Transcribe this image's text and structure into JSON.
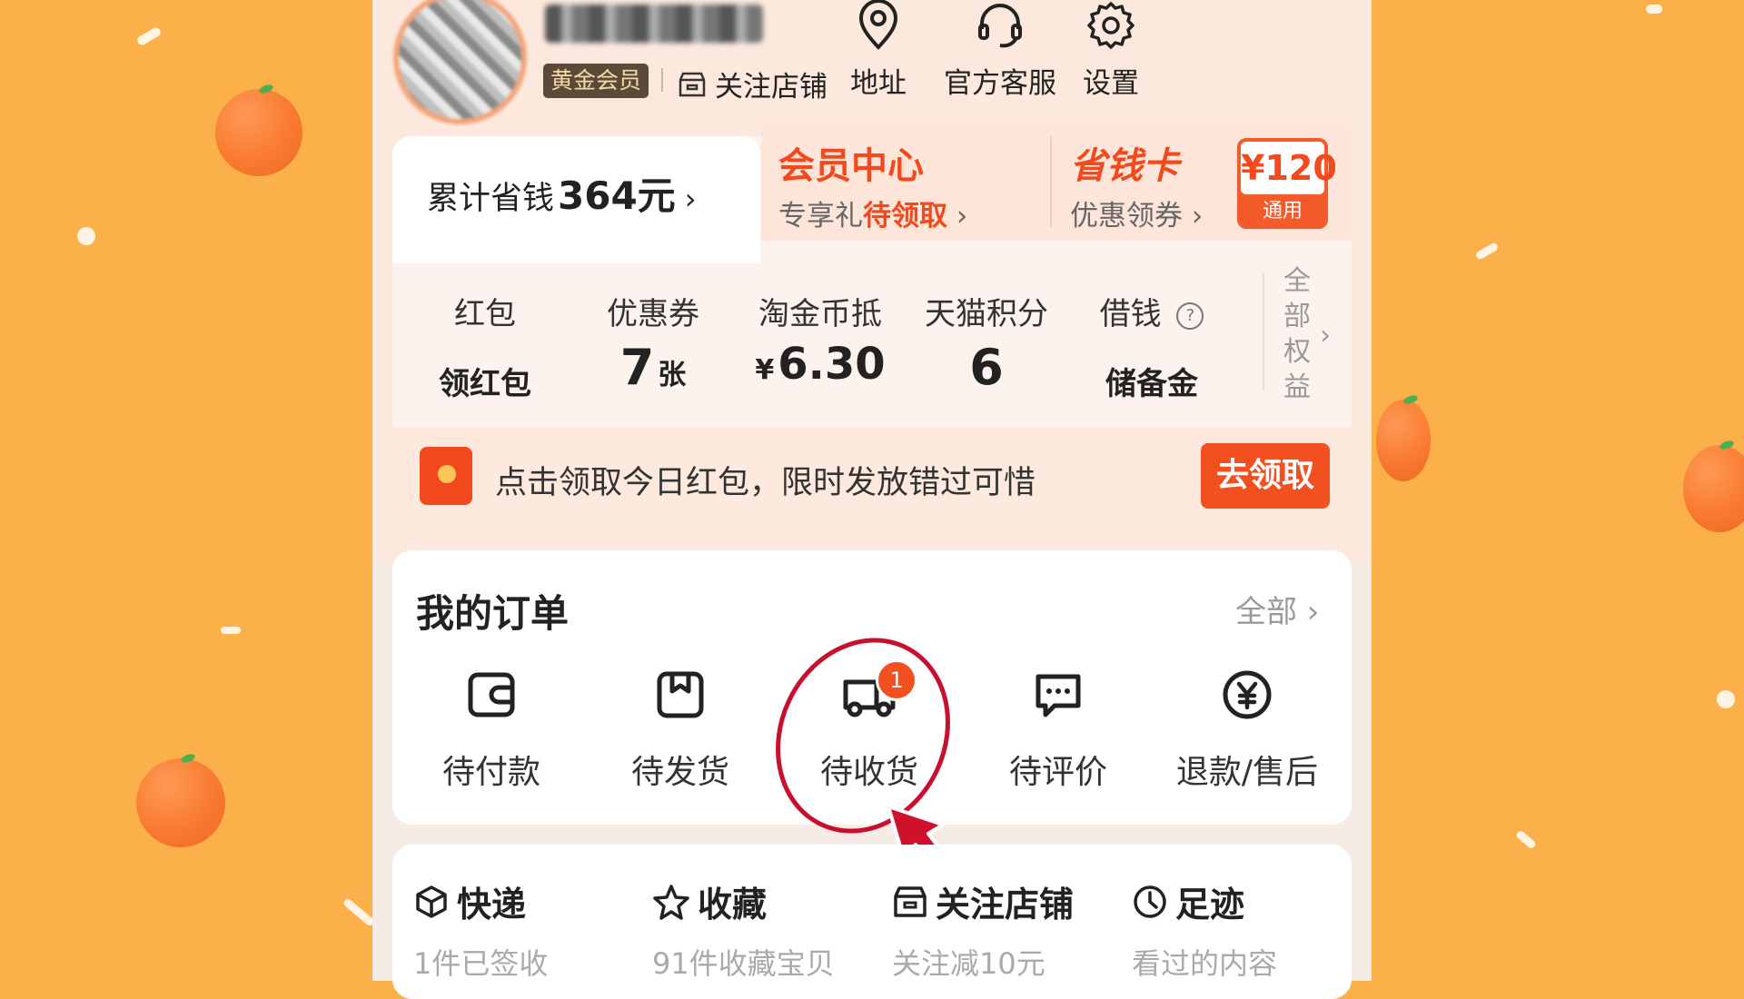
{
  "header": {
    "member_badge": "黄金会员",
    "follow_store": "关注店铺",
    "actions": [
      {
        "label": "地址",
        "icon": "location-pin-icon"
      },
      {
        "label": "官方客服",
        "icon": "headset-icon"
      },
      {
        "label": "设置",
        "icon": "gear-icon"
      }
    ]
  },
  "savings": {
    "prefix": "累计省钱",
    "amount": "364元",
    "chevron": "›"
  },
  "vip_center": {
    "title": "会员中心",
    "sub_prefix": "专享礼",
    "sub_highlight": "待领取",
    "chevron": "›"
  },
  "save_card": {
    "title": "省钱卡",
    "sub": "优惠领券 ›",
    "coupon_amount": "¥120",
    "coupon_label": "通用"
  },
  "stats": [
    {
      "label": "红包",
      "value": "领红包"
    },
    {
      "label": "优惠券",
      "value": "7",
      "unit": "张"
    },
    {
      "label": "淘金币抵",
      "yen": "¥",
      "value": "6.30"
    },
    {
      "label": "天猫积分",
      "value": "6"
    },
    {
      "label": "借钱",
      "help": "?",
      "value": "储备金"
    }
  ],
  "all_rights": [
    "全",
    "部",
    "权",
    "益"
  ],
  "all_rights_chevron": "›",
  "redpacket": {
    "text": "点击领取今日红包，限时发放错过可惜",
    "button": "去领取"
  },
  "orders": {
    "title": "我的订单",
    "all": "全部 ›",
    "items": [
      {
        "label": "待付款",
        "icon": "wallet-icon"
      },
      {
        "label": "待发货",
        "icon": "box-icon"
      },
      {
        "label": "待收货",
        "icon": "truck-icon",
        "badge": "1"
      },
      {
        "label": "待评价",
        "icon": "comment-icon"
      },
      {
        "label": "退款/售后",
        "icon": "refund-yen-icon"
      }
    ]
  },
  "shortcuts": [
    {
      "title": "快递",
      "sub": "1件已签收",
      "icon": "package-icon"
    },
    {
      "title": "收藏",
      "sub": "91件收藏宝贝",
      "icon": "star-icon"
    },
    {
      "title": "关注店铺",
      "sub": "关注减10元",
      "icon": "store-icon"
    },
    {
      "title": "足迹",
      "sub": "看过的内容",
      "icon": "clock-icon"
    }
  ],
  "colors": {
    "background": "#FBB04A",
    "accent": "#F24A1D",
    "annotation": "#C8102E"
  }
}
